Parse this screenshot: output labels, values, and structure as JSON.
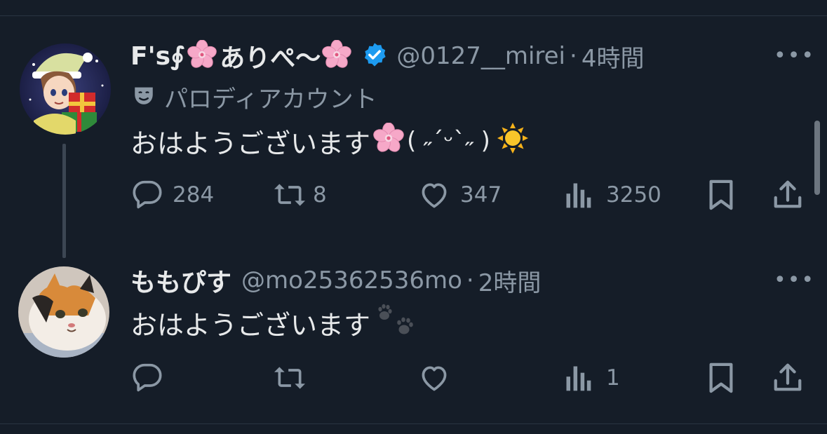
{
  "posts": [
    {
      "display_name": "F's∮",
      "display_name_suffix": "ありぺ〜",
      "handle": "@0127__mirei",
      "separator": "·",
      "time": "4時間",
      "verified": true,
      "account_label_icon": "theater-mask-icon",
      "account_label": "パロディアカウント",
      "text": "おはようございます",
      "text_kaomoji": "( ˶ˊᵕˋ˶ )",
      "actions": {
        "reply_count": "284",
        "repost_count": "8",
        "like_count": "347",
        "views_count": "3250"
      },
      "more_label": "•••"
    },
    {
      "display_name": "ももぴす",
      "handle": "@mo25362536mo",
      "separator": "·",
      "time": "2時間",
      "text": "おはようございます",
      "actions": {
        "reply_count": "",
        "repost_count": "",
        "like_count": "",
        "views_count": "1"
      },
      "more_label": "•••"
    }
  ],
  "colors": {
    "background": "#151d28",
    "text_primary": "#e7e9ea",
    "text_secondary": "#8b98a5",
    "verified_blue": "#1d9bf0",
    "divider": "#2a3442"
  }
}
